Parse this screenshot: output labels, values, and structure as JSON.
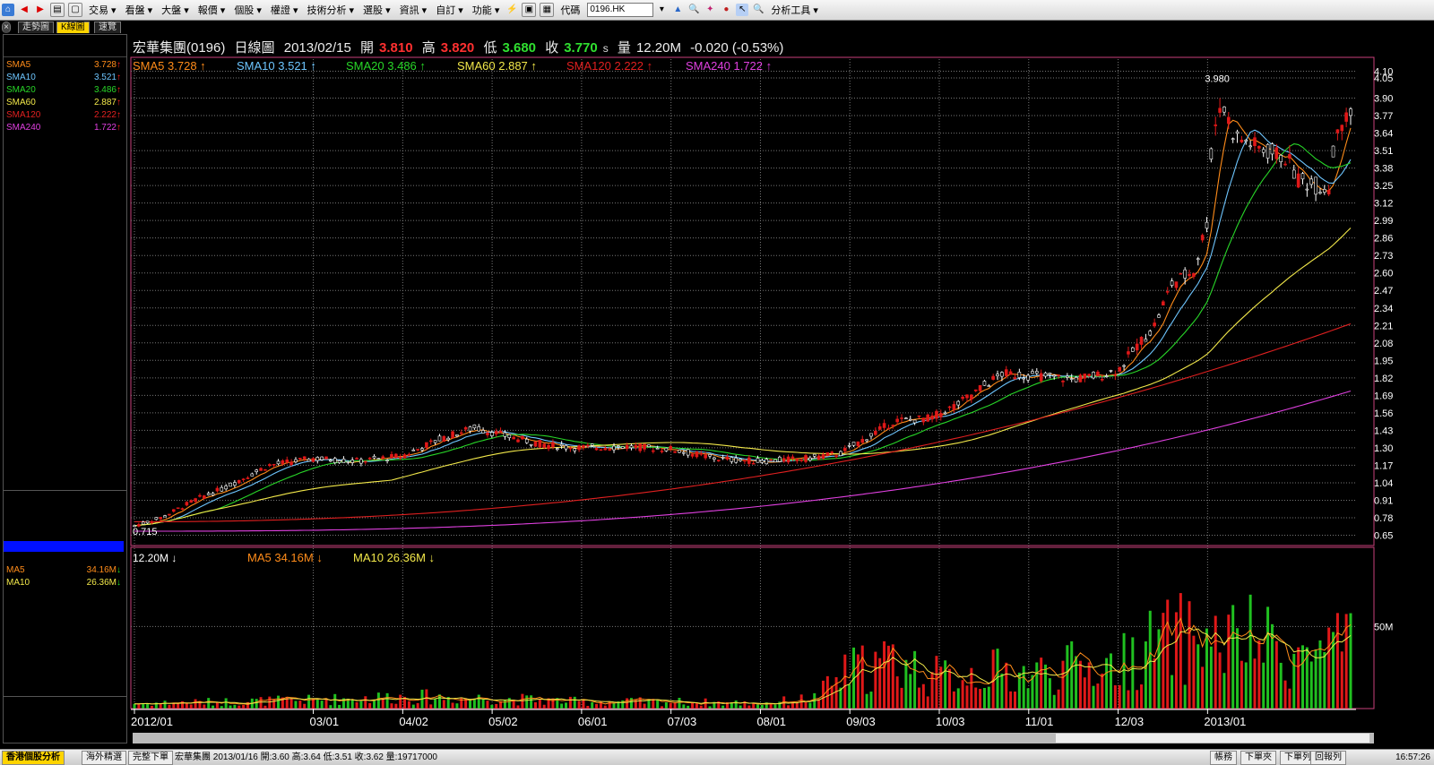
{
  "toolbar": {
    "menus": [
      "交易",
      "看盤",
      "大盤",
      "報價",
      "個股",
      "權證",
      "技術分析",
      "選股",
      "資訊",
      "自訂",
      "功能"
    ],
    "code_label": "代碼",
    "code_value": "0196.HK",
    "analysis_tools": "分析工具"
  },
  "tabs": [
    "走勢圖",
    "K線圖",
    "速覽"
  ],
  "header": {
    "name": "宏華集團(0196)",
    "period": "日線圖",
    "date": "2013/02/15",
    "open_label": "開",
    "open": "3.810",
    "high_label": "高",
    "high": "3.820",
    "low_label": "低",
    "low": "3.680",
    "close_label": "收",
    "close": "3.770",
    "close_suffix": "s",
    "volume_label": "量",
    "volume": "12.20M",
    "change": "-0.020 (-0.53%)"
  },
  "sidebar": {
    "price_ma": [
      {
        "name": "SMA5",
        "value": "3.728",
        "dir": "up",
        "color": "#ff8c1a"
      },
      {
        "name": "SMA10",
        "value": "3.521",
        "dir": "up",
        "color": "#6ec6ff"
      },
      {
        "name": "SMA20",
        "value": "3.486",
        "dir": "up",
        "color": "#28d628"
      },
      {
        "name": "SMA60",
        "value": "2.887",
        "dir": "up",
        "color": "#f2e84a"
      },
      {
        "name": "SMA120",
        "value": "2.222",
        "dir": "up",
        "color": "#e02020"
      },
      {
        "name": "SMA240",
        "value": "1.722",
        "dir": "up",
        "color": "#e040e0"
      }
    ],
    "vol_ma": [
      {
        "name": "MA5",
        "value": "34.16M",
        "dir": "down",
        "color": "#ff8c1a"
      },
      {
        "name": "MA10",
        "value": "26.36M",
        "dir": "down",
        "color": "#f2e84a"
      }
    ]
  },
  "chart_data": [
    {
      "type": "candlestick",
      "title": "宏華集團(0196) 日線圖",
      "y_ticks": [
        "4.10",
        "4.05",
        "3.90",
        "3.77",
        "3.64",
        "3.51",
        "3.38",
        "3.25",
        "3.12",
        "2.99",
        "2.86",
        "2.73",
        "2.60",
        "2.47",
        "2.34",
        "2.21",
        "2.08",
        "1.95",
        "1.82",
        "1.69",
        "1.56",
        "1.43",
        "1.30",
        "1.17",
        "1.04",
        "0.91",
        "0.78",
        "0.65"
      ],
      "ylim": [
        0.6,
        4.15
      ],
      "x_ticks": [
        "2012/01",
        "03/01",
        "04/02",
        "05/02",
        "06/01",
        "07/03",
        "08/01",
        "09/03",
        "10/03",
        "11/01",
        "12/03",
        "2013/01"
      ],
      "annotations": [
        {
          "label": "3.980",
          "kind": "period-high"
        },
        {
          "label": "0.715",
          "kind": "period-low"
        }
      ],
      "series": [
        {
          "name": "SMA5",
          "last": 3.728
        },
        {
          "name": "SMA10",
          "last": 3.521
        },
        {
          "name": "SMA20",
          "last": 3.486
        },
        {
          "name": "SMA60",
          "last": 2.887
        },
        {
          "name": "SMA120",
          "last": 2.222
        },
        {
          "name": "SMA240",
          "last": 1.722
        }
      ],
      "close_anchors": [
        {
          "m": 0.0,
          "v": 0.72
        },
        {
          "m": 0.3,
          "v": 0.78
        },
        {
          "m": 0.7,
          "v": 0.92
        },
        {
          "m": 1.0,
          "v": 1.0
        },
        {
          "m": 1.5,
          "v": 1.17
        },
        {
          "m": 2.0,
          "v": 1.22
        },
        {
          "m": 2.5,
          "v": 1.2
        },
        {
          "m": 3.0,
          "v": 1.24
        },
        {
          "m": 3.4,
          "v": 1.36
        },
        {
          "m": 3.8,
          "v": 1.45
        },
        {
          "m": 4.2,
          "v": 1.38
        },
        {
          "m": 4.6,
          "v": 1.32
        },
        {
          "m": 5.0,
          "v": 1.3
        },
        {
          "m": 5.5,
          "v": 1.31
        },
        {
          "m": 6.0,
          "v": 1.29
        },
        {
          "m": 6.5,
          "v": 1.22
        },
        {
          "m": 7.0,
          "v": 1.2
        },
        {
          "m": 7.5,
          "v": 1.22
        },
        {
          "m": 7.9,
          "v": 1.26
        },
        {
          "m": 8.2,
          "v": 1.38
        },
        {
          "m": 8.5,
          "v": 1.5
        },
        {
          "m": 8.9,
          "v": 1.52
        },
        {
          "m": 9.2,
          "v": 1.62
        },
        {
          "m": 9.5,
          "v": 1.76
        },
        {
          "m": 9.7,
          "v": 1.85
        },
        {
          "m": 10.0,
          "v": 1.84
        },
        {
          "m": 10.5,
          "v": 1.81
        },
        {
          "m": 10.8,
          "v": 1.84
        },
        {
          "m": 11.0,
          "v": 1.88
        },
        {
          "m": 11.2,
          "v": 2.05
        },
        {
          "m": 11.4,
          "v": 2.2
        },
        {
          "m": 11.6,
          "v": 2.52
        },
        {
          "m": 11.85,
          "v": 2.62
        },
        {
          "m": 12.0,
          "v": 3.0
        },
        {
          "m": 12.05,
          "v": 3.6
        },
        {
          "m": 12.15,
          "v": 3.88
        },
        {
          "m": 12.3,
          "v": 3.62
        },
        {
          "m": 12.6,
          "v": 3.52
        },
        {
          "m": 12.9,
          "v": 3.45
        },
        {
          "m": 13.0,
          "v": 3.3
        },
        {
          "m": 13.2,
          "v": 3.25
        },
        {
          "m": 13.35,
          "v": 3.22
        },
        {
          "m": 13.45,
          "v": 3.7
        },
        {
          "m": 13.6,
          "v": 3.77
        }
      ]
    },
    {
      "type": "bar",
      "title": "Volume",
      "volume_label": "12.20M",
      "y_ticks": [
        "50M"
      ],
      "ylim": [
        0,
        90
      ],
      "series": [
        {
          "name": "MA5",
          "last": "34.16M"
        },
        {
          "name": "MA10",
          "last": "26.36M"
        }
      ],
      "volume_anchors": [
        {
          "m": 0.0,
          "v": 3
        },
        {
          "m": 2.0,
          "v": 5
        },
        {
          "m": 3.0,
          "v": 7
        },
        {
          "m": 4.0,
          "v": 6
        },
        {
          "m": 5.0,
          "v": 4
        },
        {
          "m": 6.0,
          "v": 4
        },
        {
          "m": 7.0,
          "v": 3
        },
        {
          "m": 7.6,
          "v": 6
        },
        {
          "m": 8.0,
          "v": 22
        },
        {
          "m": 8.5,
          "v": 28
        },
        {
          "m": 9.0,
          "v": 18
        },
        {
          "m": 9.5,
          "v": 22
        },
        {
          "m": 10.0,
          "v": 20
        },
        {
          "m": 10.5,
          "v": 24
        },
        {
          "m": 11.0,
          "v": 25
        },
        {
          "m": 11.3,
          "v": 35
        },
        {
          "m": 11.6,
          "v": 40
        },
        {
          "m": 11.9,
          "v": 42
        },
        {
          "m": 12.1,
          "v": 38
        },
        {
          "m": 12.5,
          "v": 40
        },
        {
          "m": 13.0,
          "v": 30
        },
        {
          "m": 13.3,
          "v": 34
        },
        {
          "m": 13.6,
          "v": 34
        }
      ]
    }
  ],
  "colors": {
    "up": "#e01818",
    "down": "#20c020",
    "grid": "#777777",
    "axis": "#ffffff",
    "frame": "#c8407a",
    "vol_header_bg": "#0010ff"
  },
  "statusbar": {
    "buttons": [
      "香港個股分析",
      "海外精選",
      "完整下單"
    ],
    "quote": "宏華集團 2013/01/16 開:3.60 高:3.64 低:3.51 收:3.62 量:19717000",
    "right_buttons": [
      "帳務",
      "下單夾",
      "下單列",
      "回報列"
    ],
    "time": "16:57:26"
  }
}
